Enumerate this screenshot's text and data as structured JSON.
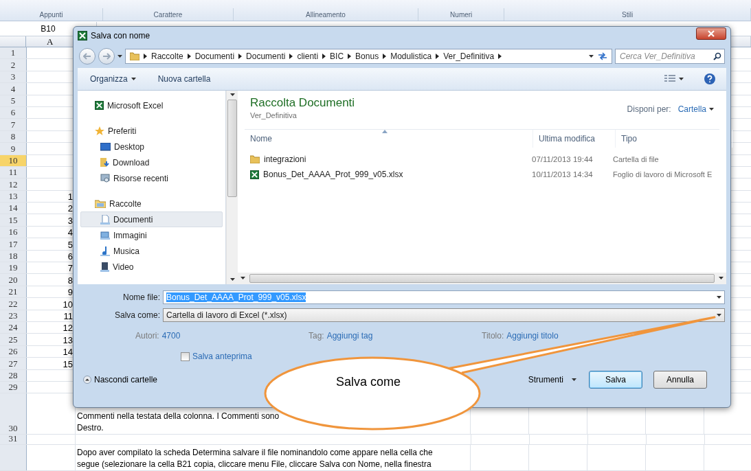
{
  "ribbon": {
    "groups": [
      "Appunti",
      "Carattere",
      "Allineamento",
      "Numeri",
      "Stili"
    ]
  },
  "name_box": "B10",
  "column_header": "A",
  "rows": [
    {
      "number": "1",
      "selected": false
    },
    {
      "number": "2",
      "selected": false
    },
    {
      "number": "3",
      "selected": false
    },
    {
      "number": "4",
      "selected": false
    },
    {
      "number": "5",
      "selected": false
    },
    {
      "number": "6",
      "selected": false
    },
    {
      "number": "7",
      "selected": false
    },
    {
      "number": "8",
      "selected": false
    },
    {
      "number": "9",
      "selected": false
    },
    {
      "number": "10",
      "selected": true
    },
    {
      "number": "11",
      "selected": false
    },
    {
      "number": "12",
      "selected": false
    },
    {
      "number": "13",
      "selected": false,
      "a": "1"
    },
    {
      "number": "14",
      "selected": false,
      "a": "2"
    },
    {
      "number": "15",
      "selected": false,
      "a": "3"
    },
    {
      "number": "16",
      "selected": false,
      "a": "4"
    },
    {
      "number": "17",
      "selected": false,
      "a": "5"
    },
    {
      "number": "18",
      "selected": false,
      "a": "6"
    },
    {
      "number": "19",
      "selected": false,
      "a": "7"
    },
    {
      "number": "20",
      "selected": false,
      "a": "8"
    },
    {
      "number": "21",
      "selected": false,
      "a": "9"
    },
    {
      "number": "22",
      "selected": false,
      "a": "10"
    },
    {
      "number": "23",
      "selected": false,
      "a": "11"
    },
    {
      "number": "24",
      "selected": false,
      "a": "12"
    },
    {
      "number": "25",
      "selected": false,
      "a": "13"
    },
    {
      "number": "26",
      "selected": false,
      "a": "14"
    },
    {
      "number": "27",
      "selected": false,
      "a": "15"
    },
    {
      "number": "28",
      "selected": false
    },
    {
      "number": "29",
      "selected": false
    },
    {
      "number": "30",
      "selected": false,
      "b": [
        "Commenti nella testata della colonna. I Commenti sono",
        "Destro."
      ]
    },
    {
      "number": "31",
      "selected": false
    },
    {
      "selected": false,
      "b": [
        "Dopo aver compilato la scheda Determina salvare il file nominandolo come appare nella cella che",
        "segue (selezionare la cella B21 copia, cliccare menu File, cliccare Salva con Nome, nella finestra"
      ]
    }
  ],
  "dialog": {
    "title": "Salva con nome",
    "breadcrumb": [
      "Raccolte",
      "Documenti",
      "Documenti",
      "clienti",
      "BIC",
      "Bonus",
      "Modulistica",
      "Ver_Definitiva"
    ],
    "search": {
      "placeholder": "Cerca Ver_Definitiva"
    },
    "toolbar": {
      "organize": "Organizza",
      "new_folder": "Nuova cartella"
    },
    "nav": [
      {
        "label": "Microsoft Excel",
        "selected": false
      },
      {
        "label": "Preferiti",
        "selected": false,
        "children": [
          {
            "label": "Desktop",
            "selected": false
          },
          {
            "label": "Download",
            "selected": false
          },
          {
            "label": "Risorse recenti",
            "selected": false
          }
        ]
      },
      {
        "label": "Raccolte",
        "selected": false,
        "children": [
          {
            "label": "Documenti",
            "selected": true
          },
          {
            "label": "Immagini",
            "selected": false
          },
          {
            "label": "Musica",
            "selected": false
          },
          {
            "label": "Video",
            "selected": false
          }
        ]
      }
    ],
    "library": {
      "title": "Raccolta Documenti",
      "subtitle": "Ver_Definitiva",
      "arrange_label": "Disponi per:",
      "arrange_value": "Cartella"
    },
    "columns": [
      "Nome",
      "Ultima modifica",
      "Tipo"
    ],
    "files": [
      {
        "kind": "folder",
        "name": "integrazioni",
        "modified": "07/11/2013 19:44",
        "type": "Cartella di file"
      },
      {
        "kind": "excel",
        "name": "Bonus_Det_AAAA_Prot_999_v05.xlsx",
        "modified": "10/11/2013 14:34",
        "type": "Foglio di lavoro di Microsoft E"
      }
    ],
    "file_name": {
      "label": "Nome file:",
      "value": "Bonus_Det_AAAA_Prot_999_v05.xlsx",
      "text_selected": true
    },
    "save_as": {
      "label": "Salva come:",
      "value": "Cartella di lavoro di Excel (*.xlsx)"
    },
    "meta": [
      {
        "label": "Autori:",
        "value": "4700"
      },
      {
        "label": "Tag:",
        "value": "Aggiungi tag"
      },
      {
        "label": "Titolo:",
        "value": "Aggiungi titolo"
      }
    ],
    "thumbnail": {
      "label": "Salva anteprima",
      "checked": false
    },
    "hide_folders": "Nascondi cartelle",
    "tools": "Strumenti",
    "buttons": [
      {
        "label": "Salva",
        "default": true
      },
      {
        "label": "Annulla",
        "default": false
      }
    ]
  },
  "callout": {
    "text": "Salva come"
  }
}
